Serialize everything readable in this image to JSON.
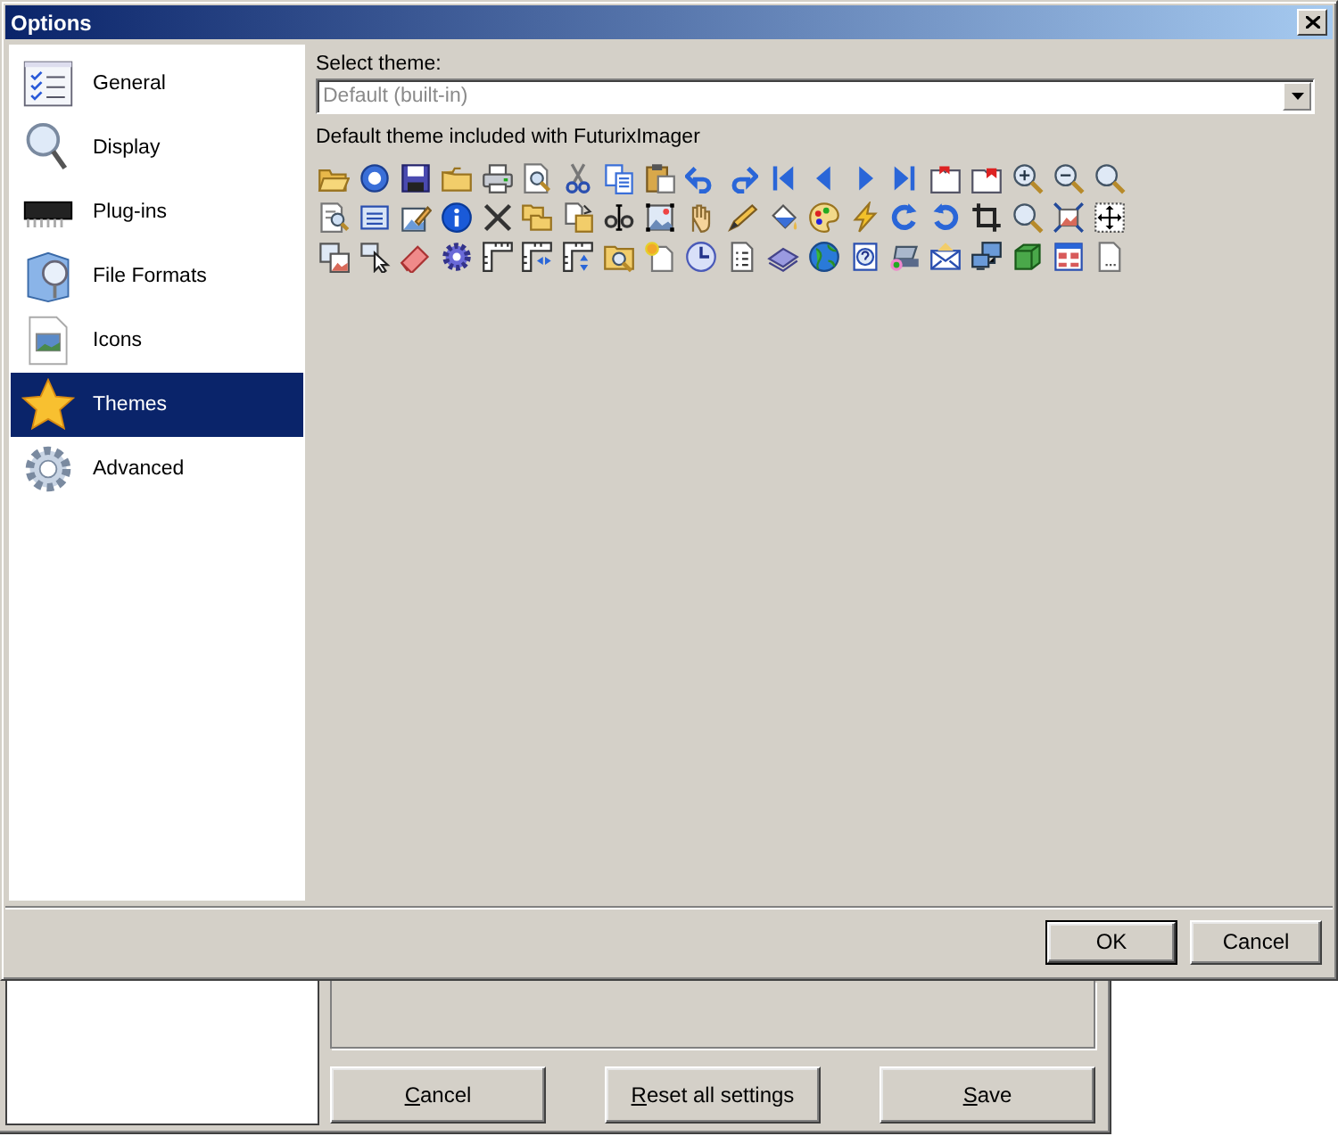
{
  "window": {
    "title": "Options"
  },
  "sidebar": {
    "items": [
      {
        "label": "General",
        "selected": false
      },
      {
        "label": "Display",
        "selected": false
      },
      {
        "label": "Plug-ins",
        "selected": false
      },
      {
        "label": "File Formats",
        "selected": false
      },
      {
        "label": "Icons",
        "selected": false
      },
      {
        "label": "Themes",
        "selected": true
      },
      {
        "label": "Advanced",
        "selected": false
      }
    ]
  },
  "theme_panel": {
    "label": "Select theme:",
    "dropdown": {
      "value": "Default (built-in)",
      "disabled": true
    },
    "description": "Default theme included with FuturixImager"
  },
  "dialog_buttons": [
    {
      "label": "OK",
      "default": true
    },
    {
      "label": "Cancel",
      "default": false
    }
  ],
  "background_window": {
    "buttons": [
      {
        "label": "Cancel",
        "mnemonic": true
      },
      {
        "label": "Reset all settings",
        "mnemonic": true
      },
      {
        "label": "Save",
        "mnemonic": true
      }
    ]
  }
}
